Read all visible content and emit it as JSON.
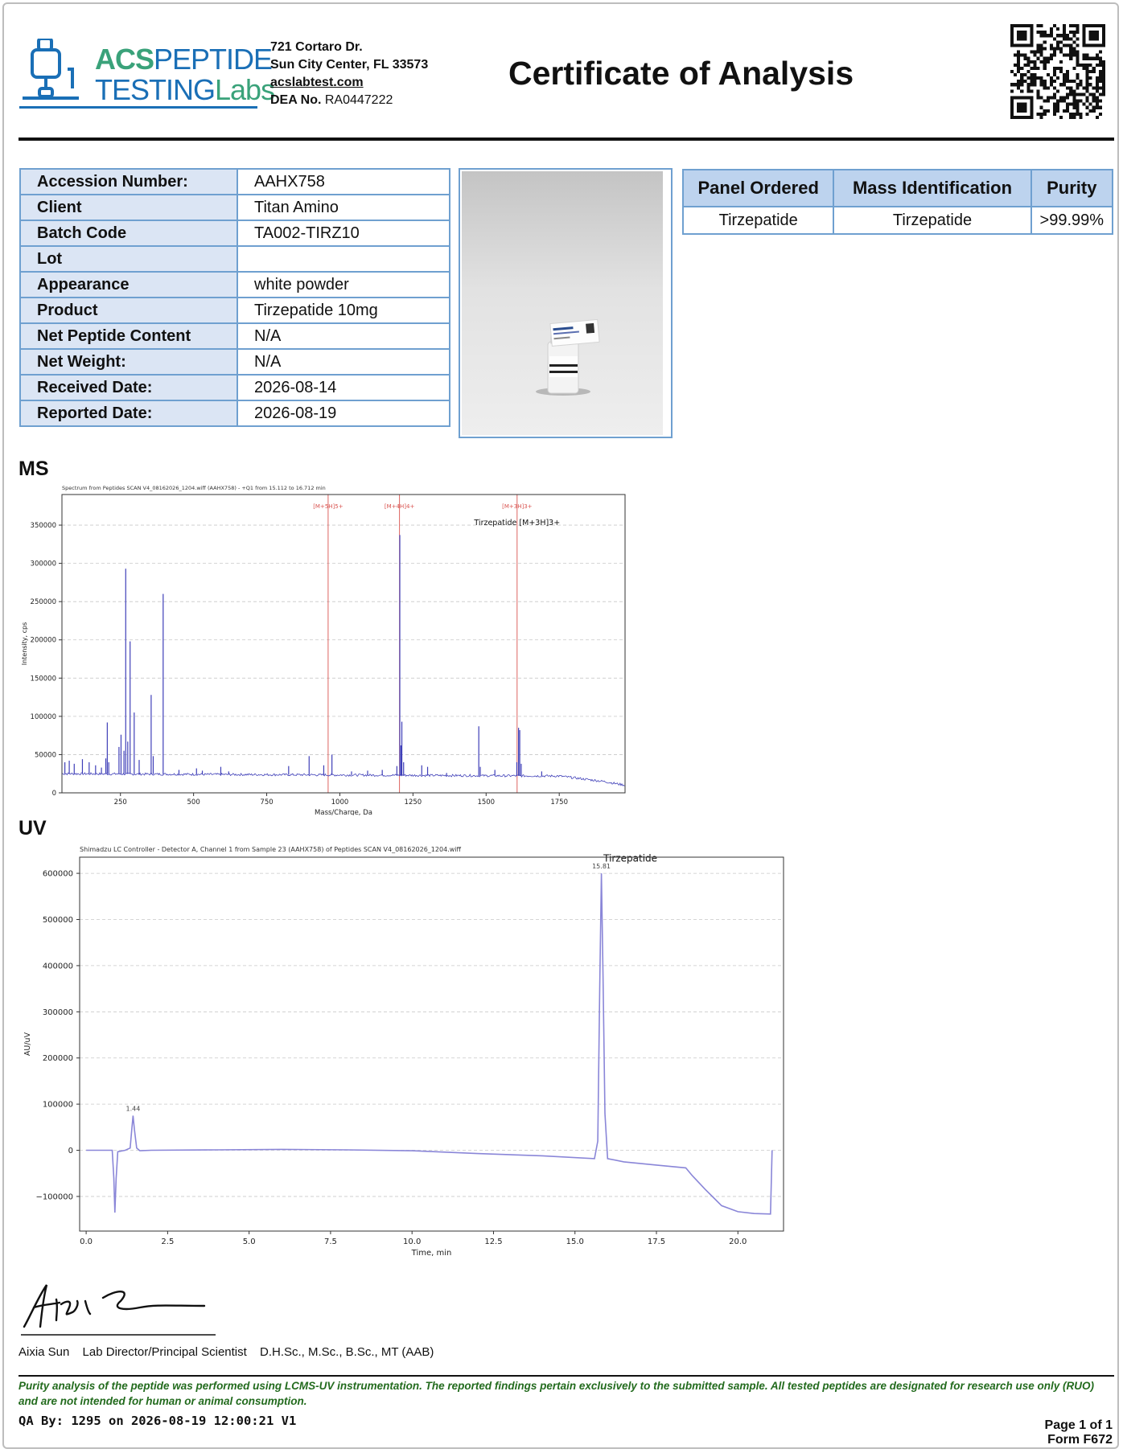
{
  "header": {
    "logo_brand_bold": "ACS",
    "logo_brand_light": "PEPTIDE",
    "logo_sub": "TESTING",
    "logo_sub_accent": "Labs",
    "address_line1": "721 Cortaro Dr.",
    "address_line2": "Sun City Center, FL 33573",
    "website": "acslabtest.com",
    "dea_label": "DEA No.",
    "dea_value": "RA0447222",
    "title": "Certificate of Analysis"
  },
  "info": {
    "rows": [
      {
        "label": "Accession Number:",
        "value": "AAHX758"
      },
      {
        "label": "Client",
        "value": "Titan Amino"
      },
      {
        "label": "Batch Code",
        "value": "TA002-TIRZ10"
      },
      {
        "label": "Lot",
        "value": ""
      },
      {
        "label": "Appearance",
        "value": "white powder"
      },
      {
        "label": "Product",
        "value": "Tirzepatide 10mg"
      },
      {
        "label": "Net Peptide Content",
        "value": "N/A"
      },
      {
        "label": "Net Weight:",
        "value": "N/A"
      },
      {
        "label": "Received Date:",
        "value": "2026-08-14"
      },
      {
        "label": "Reported Date:",
        "value": "2026-08-19"
      }
    ]
  },
  "photo": {
    "label_top": "AAHX758",
    "label_client": "Titan Amino",
    "vial_text": "Tirzepat",
    "vial_code": "TA002"
  },
  "panel": {
    "headers": [
      "Panel Ordered",
      "Mass Identification",
      "Purity"
    ],
    "row": [
      "Tirzepatide",
      "Tirzepatide",
      ">99.99%"
    ]
  },
  "sections": {
    "ms": "MS",
    "uv": "UV"
  },
  "chart_data": [
    {
      "type": "line",
      "title": "Spectrum from Peptides SCAN V4_08162026_1204.wiff (AAHX758) - +Q1 from 15.112 to 16.712 min",
      "xlabel": "Mass/Charge, Da",
      "ylabel": "Intensity, cps",
      "xlim": [
        50,
        1975
      ],
      "ylim": [
        0,
        390000
      ],
      "xticks": [
        250,
        500,
        750,
        1000,
        1250,
        1500,
        1750
      ],
      "yticks": [
        0,
        50000,
        100000,
        150000,
        200000,
        250000,
        300000,
        350000
      ],
      "grid": true,
      "baseline": [
        [
          50,
          25000
        ],
        [
          1750,
          22000
        ],
        [
          1900,
          15000
        ],
        [
          1975,
          10000
        ]
      ],
      "peaks": [
        {
          "x": 60,
          "y": 40000
        },
        {
          "x": 75,
          "y": 42000
        },
        {
          "x": 92,
          "y": 38000
        },
        {
          "x": 120,
          "y": 44000
        },
        {
          "x": 143,
          "y": 40000
        },
        {
          "x": 165,
          "y": 36000
        },
        {
          "x": 185,
          "y": 33000
        },
        {
          "x": 200,
          "y": 45000
        },
        {
          "x": 205,
          "y": 92000
        },
        {
          "x": 210,
          "y": 40000
        },
        {
          "x": 245,
          "y": 60000
        },
        {
          "x": 252,
          "y": 76000
        },
        {
          "x": 262,
          "y": 55000
        },
        {
          "x": 268,
          "y": 293000
        },
        {
          "x": 275,
          "y": 67000
        },
        {
          "x": 283,
          "y": 198000
        },
        {
          "x": 297,
          "y": 105000
        },
        {
          "x": 314,
          "y": 43000
        },
        {
          "x": 355,
          "y": 128000
        },
        {
          "x": 362,
          "y": 48000
        },
        {
          "x": 396,
          "y": 260000
        },
        {
          "x": 450,
          "y": 30000
        },
        {
          "x": 510,
          "y": 32000
        },
        {
          "x": 530,
          "y": 29000
        },
        {
          "x": 593,
          "y": 34000
        },
        {
          "x": 620,
          "y": 28000
        },
        {
          "x": 825,
          "y": 35000
        },
        {
          "x": 895,
          "y": 48000
        },
        {
          "x": 945,
          "y": 36000
        },
        {
          "x": 973,
          "y": 50000
        },
        {
          "x": 1040,
          "y": 28000
        },
        {
          "x": 1095,
          "y": 29000
        },
        {
          "x": 1145,
          "y": 30000
        },
        {
          "x": 1195,
          "y": 35000
        },
        {
          "x": 1205,
          "y": 337000
        },
        {
          "x": 1209,
          "y": 62000
        },
        {
          "x": 1212,
          "y": 93000
        },
        {
          "x": 1218,
          "y": 40000
        },
        {
          "x": 1280,
          "y": 36000
        },
        {
          "x": 1300,
          "y": 34000
        },
        {
          "x": 1365,
          "y": 26000
        },
        {
          "x": 1475,
          "y": 87000
        },
        {
          "x": 1480,
          "y": 34000
        },
        {
          "x": 1530,
          "y": 30000
        },
        {
          "x": 1605,
          "y": 40000
        },
        {
          "x": 1611,
          "y": 85000
        },
        {
          "x": 1615,
          "y": 82000
        },
        {
          "x": 1620,
          "y": 38000
        },
        {
          "x": 1690,
          "y": 28000
        }
      ],
      "markers": [
        {
          "x": 960,
          "label": "[M+5H]5+"
        },
        {
          "x": 1204,
          "label": "[M+4H]4+"
        },
        {
          "x": 1606,
          "label": "[M+3H]3+"
        }
      ],
      "annotation": {
        "x": 1606,
        "y": 350000,
        "text": "Tirzepatide [M+3H]3+"
      }
    },
    {
      "type": "line",
      "title": "Shimadzu LC Controller - Detector A, Channel 1 from Sample 23 (AAHX758) of Peptides SCAN V4_08162026_1204.wiff",
      "xlabel": "Time, min",
      "ylabel": "AU/uV",
      "xlim": [
        -0.2,
        21.4
      ],
      "ylim": [
        -175000,
        635000
      ],
      "xticks": [
        0.0,
        2.5,
        5.0,
        7.5,
        10.0,
        12.5,
        15.0,
        17.5,
        20.0
      ],
      "yticks": [
        -100000,
        0,
        100000,
        200000,
        300000,
        400000,
        500000,
        600000
      ],
      "grid": true,
      "points": [
        [
          0.0,
          0
        ],
        [
          0.8,
          0
        ],
        [
          0.85,
          -60000
        ],
        [
          0.88,
          -135000
        ],
        [
          0.92,
          -60000
        ],
        [
          0.97,
          -3000
        ],
        [
          1.2,
          0
        ],
        [
          1.35,
          5000
        ],
        [
          1.4,
          45000
        ],
        [
          1.44,
          75000
        ],
        [
          1.48,
          45000
        ],
        [
          1.55,
          5000
        ],
        [
          1.65,
          -1000
        ],
        [
          2.0,
          0
        ],
        [
          4.0,
          1000
        ],
        [
          6.0,
          2000
        ],
        [
          8.0,
          1000
        ],
        [
          10.0,
          -1000
        ],
        [
          12.0,
          -7000
        ],
        [
          14.0,
          -12000
        ],
        [
          15.6,
          -18000
        ],
        [
          15.7,
          20000
        ],
        [
          15.76,
          350000
        ],
        [
          15.81,
          600000
        ],
        [
          15.86,
          380000
        ],
        [
          15.92,
          80000
        ],
        [
          16.0,
          -18000
        ],
        [
          16.5,
          -25000
        ],
        [
          17.5,
          -32000
        ],
        [
          18.4,
          -38000
        ],
        [
          18.6,
          -55000
        ],
        [
          19.0,
          -85000
        ],
        [
          19.5,
          -120000
        ],
        [
          20.0,
          -133000
        ],
        [
          20.5,
          -137000
        ],
        [
          21.0,
          -138000
        ],
        [
          21.05,
          0
        ]
      ],
      "peak_labels": [
        {
          "x": 1.44,
          "y": 75000,
          "text": "1.44"
        },
        {
          "x": 15.81,
          "y": 600000,
          "text": "15.81"
        }
      ],
      "annotation": {
        "x": 16.7,
        "y": 625000,
        "text": "Tirzepatide"
      }
    }
  ],
  "signature": {
    "name": "Aixia Sun",
    "role": "Lab Director/Principal Scientist",
    "credentials": "D.H.Sc., M.Sc., B.Sc., MT (AAB)"
  },
  "disclaimer": "Purity analysis of the peptide was performed using LCMS-UV instrumentation. The reported findings pertain exclusively to the submitted sample. All tested peptides are designated for research use only (RUO) and are not intended for human or animal consumption.",
  "footer": {
    "qa": "QA By: 1295 on 2026-08-19 12:00:21 V1",
    "page": "Page 1 of 1",
    "form": "Form F672"
  },
  "colors": {
    "accent_blue": "#1a6fb6",
    "accent_green": "#3aa27a",
    "table_border": "#6fa0d0",
    "header_fill": "#bdd3ee",
    "ms_line": "#3f3fb8",
    "uv_line": "#8a86d8",
    "marker_red": "#d9534f",
    "disclaimer_green": "#236b1e"
  }
}
